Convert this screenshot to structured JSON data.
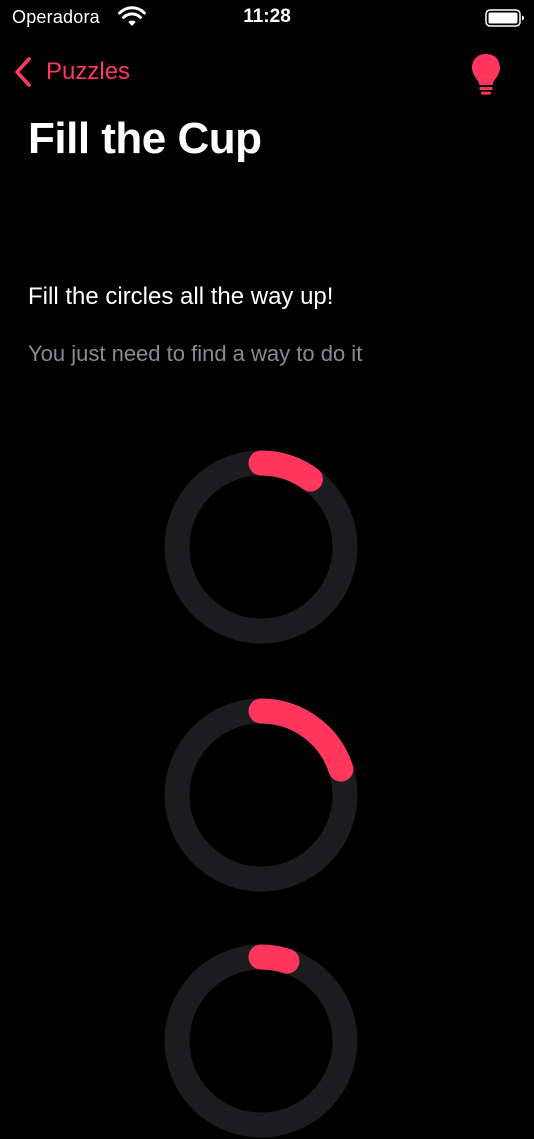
{
  "status_bar": {
    "carrier": "Operadora",
    "time": "11:28"
  },
  "nav": {
    "back_label": "Puzzles",
    "hint_icon": "lightbulb-icon"
  },
  "page": {
    "title": "Fill the Cup",
    "instruction": "Fill the circles all the way up!",
    "subtext": "You just need to find a way to do it"
  },
  "colors": {
    "accent": "#ff375f",
    "track": "#1c1c1e",
    "background": "#000000",
    "secondary_text": "#8a8a8f"
  },
  "rings": [
    {
      "name": "cup-ring-1",
      "progress": 0.1
    },
    {
      "name": "cup-ring-2",
      "progress": 0.2
    },
    {
      "name": "cup-ring-3",
      "progress": 0.05
    }
  ]
}
